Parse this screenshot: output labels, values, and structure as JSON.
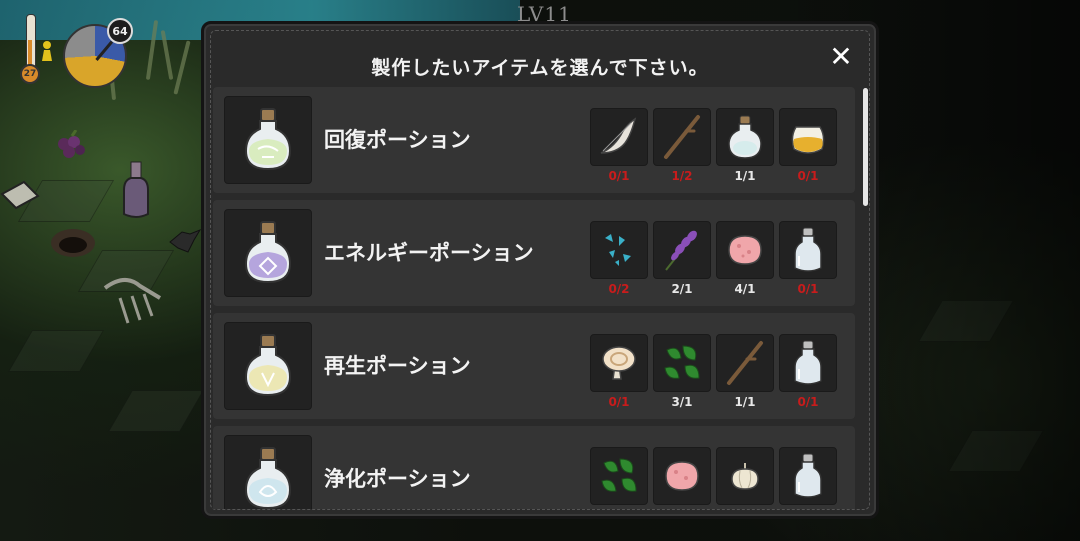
{
  "hud": {
    "level_label": "LV11",
    "temperature": "27",
    "day_count": "64"
  },
  "panel": {
    "title": "製作したいアイテムを選んで下さい。",
    "close_label": "✕"
  },
  "recipes": [
    {
      "name": "回復ポーション",
      "potion_color": "#d9ecbf",
      "ingredients": [
        {
          "icon": "feather-herb-icon",
          "count": "0/1",
          "sufficient": false
        },
        {
          "icon": "branch-icon",
          "count": "1/2",
          "sufficient": false
        },
        {
          "icon": "small-potion-icon",
          "count": "1/1",
          "sufficient": true
        },
        {
          "icon": "honey-jar-icon",
          "count": "0/1",
          "sufficient": false
        }
      ]
    },
    {
      "name": "エネルギーポーション",
      "potion_color": "#b5a5dd",
      "ingredients": [
        {
          "icon": "blue-crystals-icon",
          "count": "0/2",
          "sufficient": false
        },
        {
          "icon": "lavender-icon",
          "count": "2/1",
          "sufficient": true
        },
        {
          "icon": "pink-stone-icon",
          "count": "4/1",
          "sufficient": true
        },
        {
          "icon": "empty-bottle-icon",
          "count": "0/1",
          "sufficient": false
        }
      ]
    },
    {
      "name": "再生ポーション",
      "potion_color": "#ece7b4",
      "ingredients": [
        {
          "icon": "mushroom-icon",
          "count": "0/1",
          "sufficient": false
        },
        {
          "icon": "green-leaves-icon",
          "count": "3/1",
          "sufficient": true
        },
        {
          "icon": "branch-icon",
          "count": "1/1",
          "sufficient": true
        },
        {
          "icon": "empty-bottle-icon",
          "count": "0/1",
          "sufficient": false
        }
      ]
    },
    {
      "name": "浄化ポーション",
      "potion_color": "#cfe6ee",
      "ingredients": [
        {
          "icon": "green-leaves-icon",
          "count": "",
          "sufficient": true
        },
        {
          "icon": "pink-stone-icon",
          "count": "",
          "sufficient": true
        },
        {
          "icon": "garlic-icon",
          "count": "",
          "sufficient": false
        },
        {
          "icon": "empty-bottle-icon",
          "count": "",
          "sufficient": false
        }
      ]
    }
  ],
  "colors": {
    "shortage": "#c81c1c",
    "enough": "#e8e8e8",
    "panel_bg": "#2a2a2a",
    "row_bg": "#343434"
  }
}
